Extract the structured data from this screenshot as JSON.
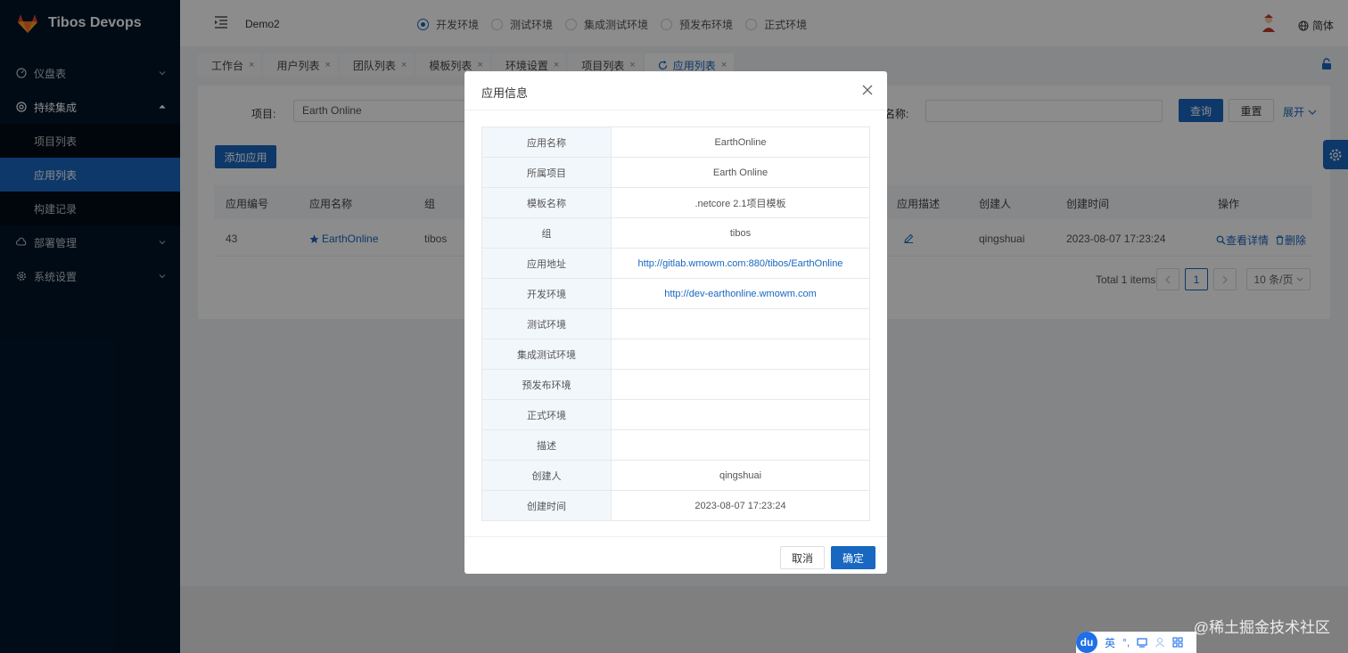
{
  "brand": {
    "title": "Tibos Devops",
    "logo_icon": "gitlab-fox-icon",
    "color": "#e24329"
  },
  "sidebar": {
    "items": [
      {
        "label": "仪盘表",
        "icon": "dashboard-icon"
      },
      {
        "label": "持续集成",
        "icon": "integration-icon"
      },
      {
        "label": "部署管理",
        "icon": "cloud-icon"
      },
      {
        "label": "系统设置",
        "icon": "gear-icon"
      }
    ],
    "subitems": [
      {
        "label": "项目列表"
      },
      {
        "label": "应用列表"
      },
      {
        "label": "构建记录"
      }
    ]
  },
  "header": {
    "project": "Demo2",
    "envs": [
      "开发环境",
      "测试环境",
      "集成测试环境",
      "预发布环境",
      "正式环境"
    ],
    "selected_env": "开发环境",
    "lang": "简体"
  },
  "tabs": [
    "工作台",
    "用户列表",
    "团队列表",
    "模板列表",
    "环境设置",
    "项目列表",
    "应用列表"
  ],
  "filter": {
    "project_label": "项目:",
    "project_value": "Earth Online",
    "name_label": "名称:",
    "query": "查询",
    "reset": "重置",
    "expand": "展开"
  },
  "add_button": "添加应用",
  "table": {
    "headers": [
      "应用编号",
      "应用名称",
      "组",
      "应用描述",
      "创建人",
      "创建时间",
      "操作"
    ],
    "row": {
      "id": "43",
      "name": "EarthOnline",
      "group": "tibos",
      "creator": "qingshuai",
      "created": "2023-08-07 17:23:24",
      "view": "查看详情",
      "delete": "删除"
    }
  },
  "pagination": {
    "total": "Total 1 items",
    "page": "1",
    "page_size": "10 条/页"
  },
  "modal": {
    "title": "应用信息",
    "rows": [
      {
        "key": "应用名称",
        "value": "EarthOnline"
      },
      {
        "key": "所属项目",
        "value": "Earth Online"
      },
      {
        "key": "模板名称",
        "value": ".netcore 2.1项目模板"
      },
      {
        "key": "组",
        "value": "tibos"
      },
      {
        "key": "应用地址",
        "value": "http://gitlab.wmowm.com:880/tibos/EarthOnline"
      },
      {
        "key": "开发环境",
        "value": "http://dev-earthonline.wmowm.com"
      },
      {
        "key": "测试环境",
        "value": ""
      },
      {
        "key": "集成测试环境",
        "value": ""
      },
      {
        "key": "预发布环境",
        "value": ""
      },
      {
        "key": "正式环境",
        "value": ""
      },
      {
        "key": "描述",
        "value": ""
      },
      {
        "key": "创建人",
        "value": "qingshuai"
      },
      {
        "key": "创建时间",
        "value": "2023-08-07 17:23:24"
      }
    ],
    "cancel": "取消",
    "ok": "确定"
  },
  "ime": {
    "logo": "du",
    "mode": "英"
  },
  "watermark": "@稀土掘金技术社区",
  "colors": {
    "primary": "#1867c0",
    "sidebar": "#001529"
  }
}
